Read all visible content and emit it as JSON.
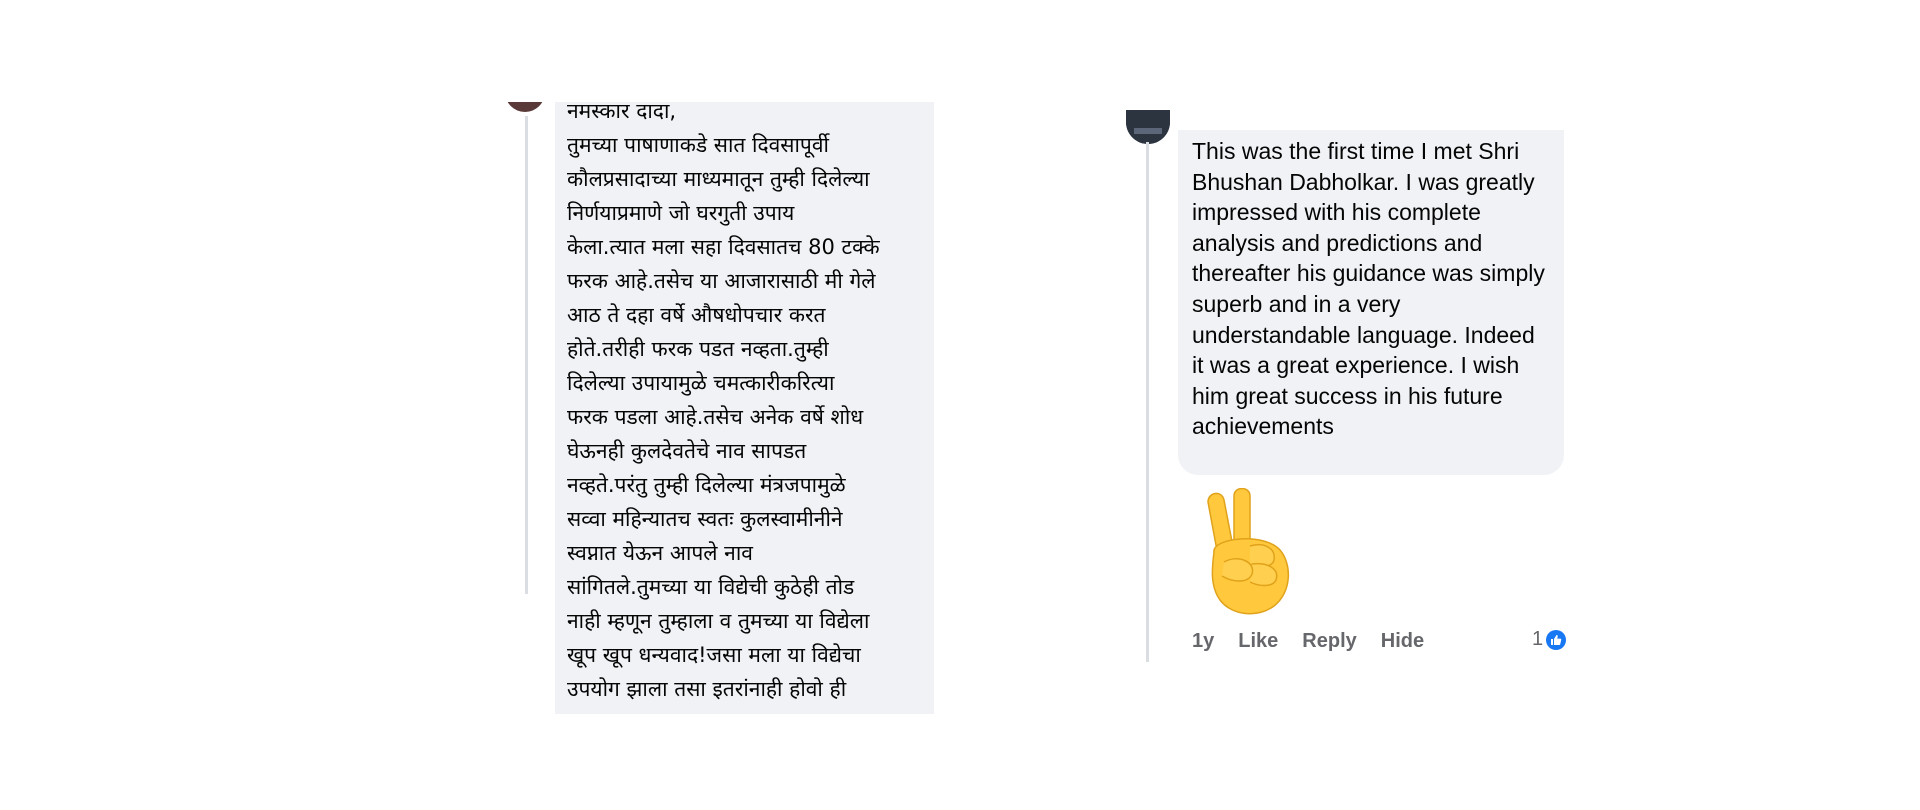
{
  "left_comment": {
    "text": "नमस्कार दादा,\n      तुमच्या पाषाणाकडे सात दिवसापूर्वी\nकौलप्रसादाच्या माध्यमातून तुम्ही दिलेल्या\nनिर्णयाप्रमाणे जो घरगुती उपाय\nकेला.त्यात मला सहा दिवसातच 80 टक्के\nफरक आहे.तसेच या आजारासाठी मी गेले\nआठ ते दहा वर्षे औषधोपचार करत\nहोते.तरीही फरक पडत नव्हता.तुम्ही\nदिलेल्या उपायामुळे चमत्कारीकरित्या\nफरक पडला आहे.तसेच अनेक वर्षे शोध\nघेऊनही कुलदेवतेचे नाव सापडत\nनव्हते.परंतु तुम्ही दिलेल्या मंत्रजपामुळे\nसव्वा महिन्यातच स्वतः कुलस्वामीनीने\nस्वप्नात येऊन  आपले नाव\nसांगितले.तुमच्या या विद्येची कुठेही तोड\nनाही म्हणून तुम्हाला व तुमच्या या विद्येला\nखूप खूप धन्यवाद!जसा मला या विद्येचा\nउपयोग झाला तसा इतरांनाही होवो ही"
  },
  "right_comment": {
    "text": "This was the first time I met Shri Bhushan Dabholkar. I was greatly impressed with his complete analysis and predictions and thereafter his guidance was simply superb and in a very understandable language. Indeed it was a great experience. I wish him great success in his future achievements",
    "emoji_icon": "victory-hand-icon",
    "actions": {
      "time": "1y",
      "like": "Like",
      "reply": "Reply",
      "hide": "Hide"
    },
    "reaction_count": "1",
    "reaction_icon": "thumbs-up-icon",
    "colors": {
      "bubble": "#f0f2f5",
      "action_text": "#65676b",
      "like_badge": "#1877f2",
      "emoji_yellow": "#ffc83d"
    }
  }
}
